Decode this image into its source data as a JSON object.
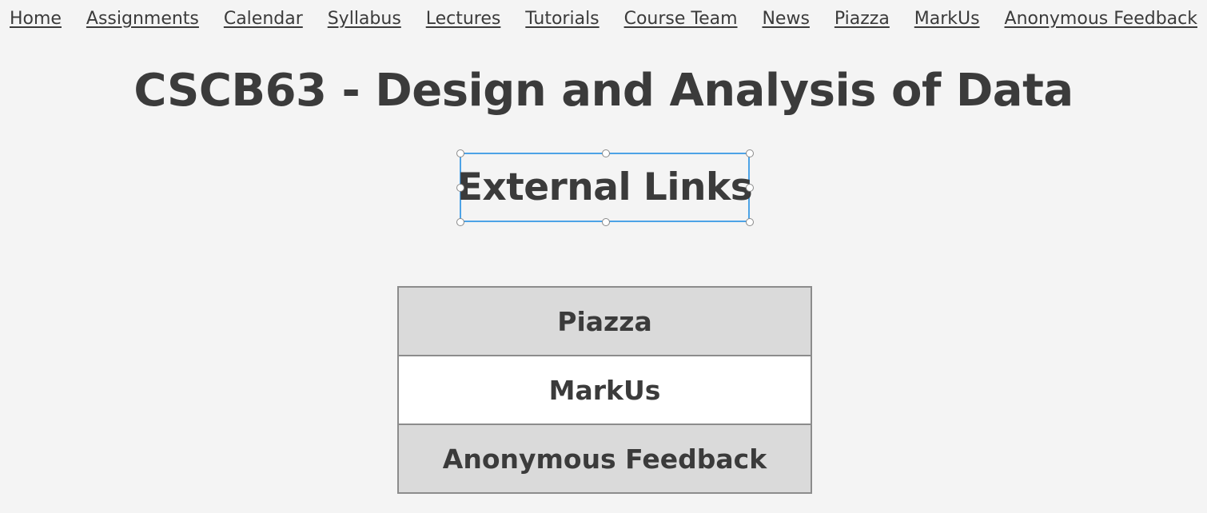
{
  "nav": {
    "items": [
      {
        "label": "Home"
      },
      {
        "label": "Assignments"
      },
      {
        "label": "Calendar"
      },
      {
        "label": "Syllabus"
      },
      {
        "label": "Lectures"
      },
      {
        "label": "Tutorials"
      },
      {
        "label": "Course Team"
      },
      {
        "label": "News"
      },
      {
        "label": "Piazza"
      },
      {
        "label": "MarkUs"
      },
      {
        "label": "Anonymous Feedback"
      }
    ]
  },
  "page": {
    "title": "CSCB63 - Design and Analysis of Data"
  },
  "section": {
    "heading": "External Links"
  },
  "links_table": {
    "rows": [
      {
        "label": "Piazza"
      },
      {
        "label": "MarkUs"
      },
      {
        "label": "Anonymous Feedback"
      }
    ]
  },
  "colors": {
    "background": "#f4f4f4",
    "text": "#3b3b3b",
    "selection_border": "#4da3e6",
    "shaded_row": "#dadada",
    "plain_row": "#ffffff",
    "table_border": "#8c8c8c"
  }
}
